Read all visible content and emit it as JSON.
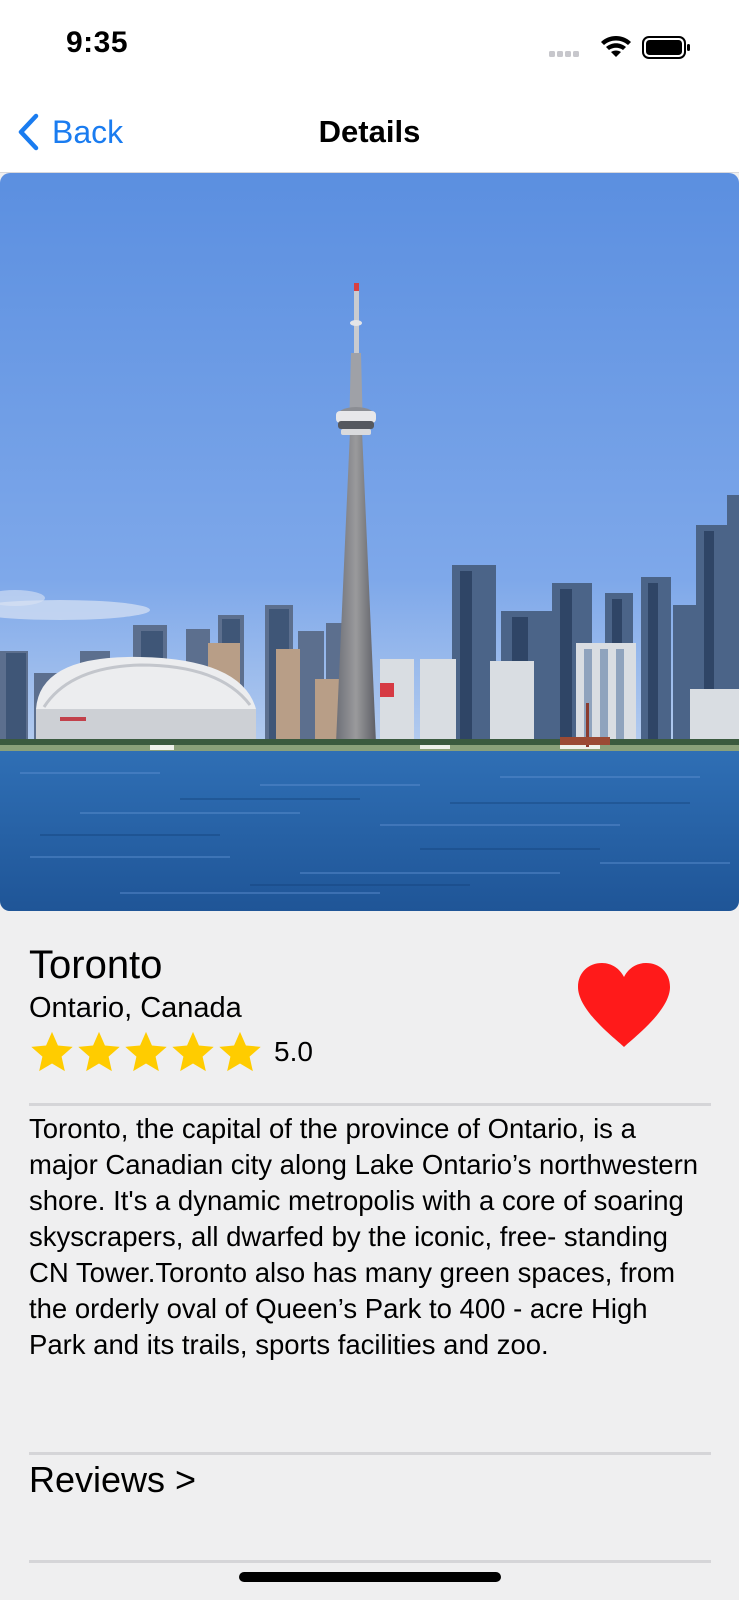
{
  "status_bar": {
    "time": "9:35",
    "icons": [
      "cellular-signal-icon",
      "wifi-icon",
      "battery-icon"
    ]
  },
  "nav": {
    "back_label": "Back",
    "title": "Details",
    "accent_color": "#1a7cf0"
  },
  "hero": {
    "description_icon": "toronto-skyline-photo"
  },
  "place": {
    "name": "Toronto",
    "region": "Ontario, Canada",
    "rating_value": "5.0",
    "stars_filled": 5,
    "stars_total": 5,
    "favorite": true,
    "favorite_color": "#ff1a1a",
    "star_color": "#ffcc00",
    "description": "Toronto, the capital of the province of Ontario, is a major Canadian city along Lake Ontario’s northwestern shore. It's a dynamic metropolis with a core of soaring skyscrapers, all dwarfed by the iconic, free- standing CN Tower.Toronto also has many green spaces, from the orderly oval of Queen’s Park to 400 - acre High Park and its trails, sports facilities and zoo."
  },
  "reviews": {
    "label": "Reviews >"
  }
}
